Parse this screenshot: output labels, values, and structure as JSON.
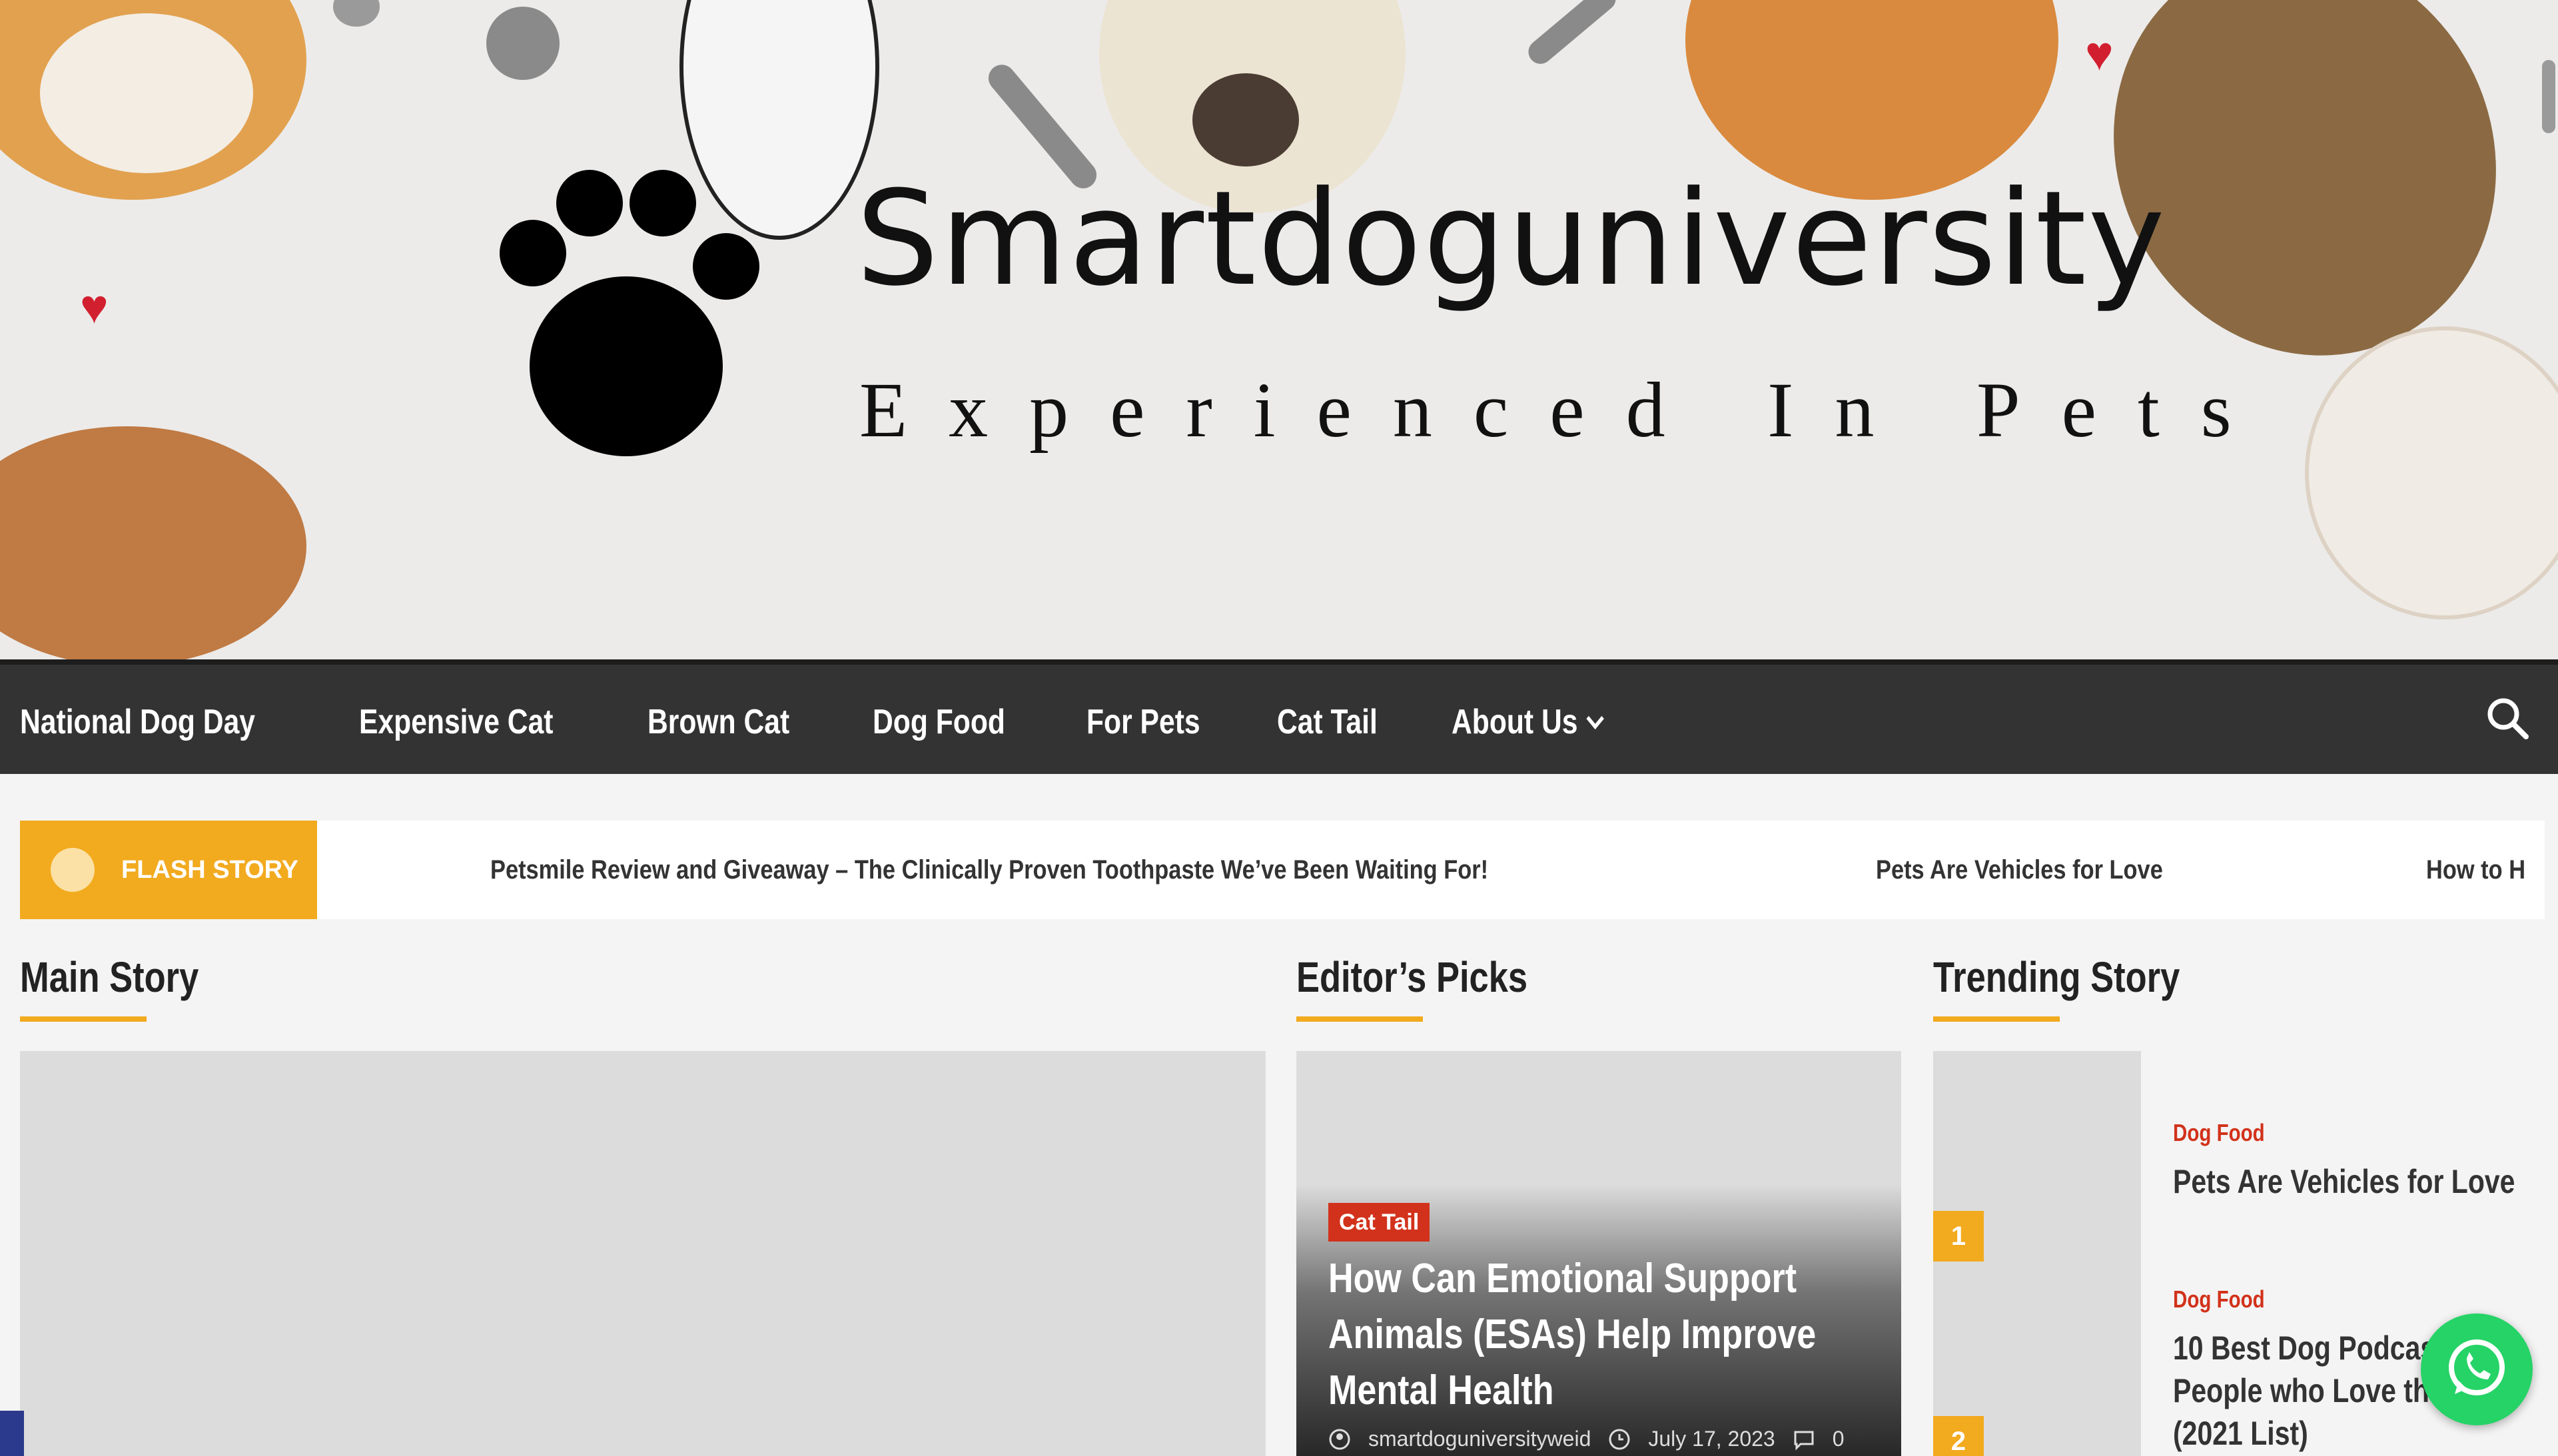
{
  "brand": {
    "title": "Smartdoguniversity",
    "tagline": "Experienced In Pets"
  },
  "nav": {
    "items": [
      "National Dog Day",
      "Expensive Cat",
      "Brown Cat",
      "Dog Food",
      "For Pets",
      "Cat Tail"
    ],
    "about_label": "About Us"
  },
  "flash": {
    "label": "FLASH STORY",
    "items": [
      "Petsmile Review and Giveaway – The Clinically Proven Toothpaste We’ve Been Waiting For!",
      "Pets Are Vehicles for Love",
      "How to H"
    ]
  },
  "sections": {
    "main": "Main Story",
    "editor": "Editor’s Picks",
    "trending": "Trending Story"
  },
  "editor_pick": {
    "category": "Cat Tail",
    "title": "How Can Emotional Support Animals (ESAs) Help Improve Mental Health",
    "author": "smartdoguniversityweid",
    "date": "July 17, 2023",
    "comments": "0"
  },
  "trending": [
    {
      "num": "1",
      "category": "Dog Food",
      "title_lines": [
        "Pets Are Vehicles for Love"
      ]
    },
    {
      "num": "2",
      "category": "Dog Food",
      "title_lines": [
        "10 Best Dog Podcasts",
        "People who Love their",
        "(2021 List)"
      ]
    }
  ],
  "colors": {
    "accent": "#f2aa1f",
    "category_red": "#d2321b",
    "nav_bg": "#333333",
    "whatsapp": "#25d366"
  },
  "icons": [
    "paw-icon",
    "search-icon",
    "chevron-down-icon",
    "user-icon",
    "clock-icon",
    "comment-icon",
    "whatsapp-icon"
  ]
}
